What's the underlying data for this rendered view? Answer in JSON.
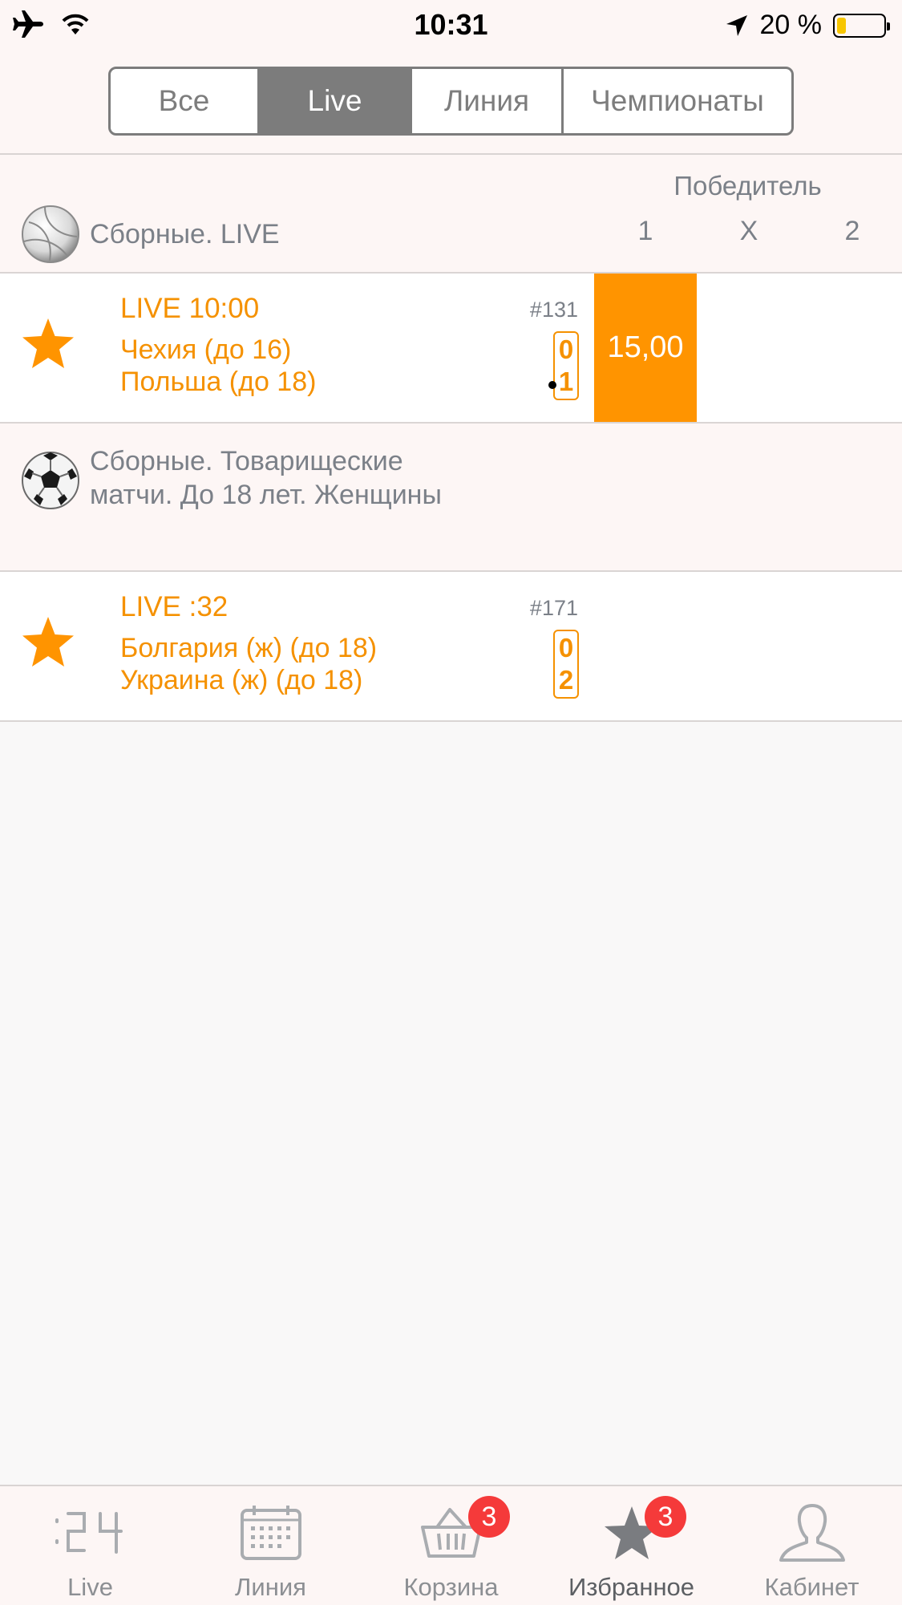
{
  "status_bar": {
    "time": "10:31",
    "battery_text": "20 %",
    "battery_level": 0.2,
    "icons": [
      "airplane-icon",
      "wifi-icon",
      "location-arrow-icon",
      "battery-icon"
    ]
  },
  "segments": [
    {
      "label": "Все",
      "active": false
    },
    {
      "label": "Live",
      "active": true
    },
    {
      "label": "Линия",
      "active": false
    },
    {
      "label": "Чемпионаты",
      "active": false
    }
  ],
  "leagues": [
    {
      "icon": "volleyball-icon",
      "name": "Сборные. LIVE",
      "market_title": "Победитель",
      "columns": [
        "1",
        "X",
        "2"
      ]
    },
    {
      "icon": "soccer-ball-icon",
      "name": "Сборные. Товарищеские матчи. До 18 лет. Женщины"
    }
  ],
  "matches": [
    {
      "status": "LIVE 10:00",
      "team1": "Чехия (до 16)",
      "team2": "Польша (до 18)",
      "number": "#131",
      "score1": "0",
      "score2": "1",
      "odd_1": "15,00"
    },
    {
      "status": "LIVE :32",
      "team1": "Болгария (ж) (до 18)",
      "team2": "Украина (ж) (до 18)",
      "number": "#171",
      "score1": "0",
      "score2": "2"
    }
  ],
  "tabbar": [
    {
      "label": "Live",
      "icon": "live-clock-icon"
    },
    {
      "label": "Линия",
      "icon": "calendar-icon"
    },
    {
      "label": "Корзина",
      "icon": "basket-icon",
      "badge": "3"
    },
    {
      "label": "Избранное",
      "icon": "star-icon",
      "badge": "3",
      "active": true
    },
    {
      "label": "Кабинет",
      "icon": "user-icon"
    }
  ],
  "colors": {
    "accent_orange": "#ff9400",
    "text_orange": "#f59100",
    "badge_red": "#f53a3a",
    "segment_gray": "#7c7c7c"
  }
}
